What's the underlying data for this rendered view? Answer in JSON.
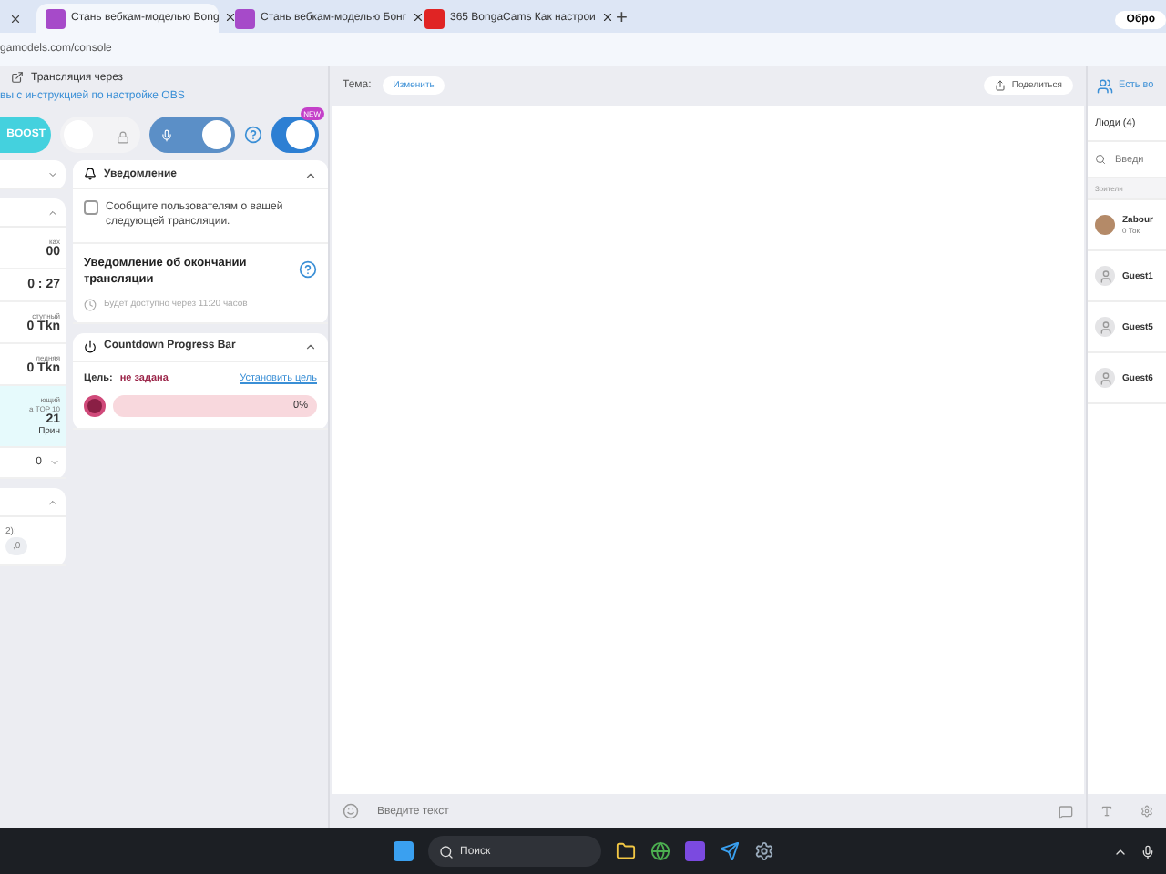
{
  "browser": {
    "tabs": [
      {
        "selected": false
      },
      {
        "title": "Стань вебкам-моделью Bong",
        "selected": true,
        "kind": "bonga"
      },
      {
        "title": "Стань вебкам-моделью Бонг",
        "selected": false,
        "kind": "bonga"
      },
      {
        "title": "365 BongaCams Как настрои",
        "selected": false,
        "kind": "video"
      }
    ],
    "new_tab": "+",
    "profile_button": "Обро",
    "address": "gamodels.com/console"
  },
  "stream": {
    "title": "Трансляция через",
    "link": "вы с инструкцией по настройке OBS",
    "controls": [
      {
        "kind": "boost",
        "label": "BOOST"
      },
      {
        "kind": "toggle",
        "on": false
      },
      {
        "kind": "mic",
        "on": true
      },
      {
        "kind": "help"
      },
      {
        "kind": "badge_toggle",
        "on": true,
        "badge": "NEW"
      }
    ]
  },
  "stats_column": {
    "cards": [
      {
        "expanded": false
      },
      {
        "expanded": true,
        "items": [
          {
            "kind": "stat",
            "label": "ках",
            "value": "00"
          },
          {
            "kind": "stat",
            "value": "0 : 27"
          },
          {
            "kind": "stat",
            "label": "ступный",
            "value": "0 Tkn"
          },
          {
            "kind": "stat",
            "label": "ледняя",
            "value": "0 Tkn"
          },
          {
            "kind": "highlight",
            "label": "ющий",
            "sub": "а TOP 10",
            "value": "21",
            "note": "Прин"
          },
          {
            "kind": "likes",
            "value": "0"
          }
        ]
      },
      {
        "expanded": true,
        "items": [
          {
            "kind": "stat",
            "label": "2):",
            "value": ",0"
          }
        ]
      }
    ]
  },
  "notification": {
    "title": "Уведомление",
    "checked": false,
    "text": "Сообщите пользователям о вашей следующей трансляции.",
    "end_title": "Уведомление об окончании трансляции",
    "available": "Будет доступно через 11:20 часов"
  },
  "countdown": {
    "title": "Countdown Progress Bar",
    "goal_label": "Цель:",
    "goal_value": "не задана",
    "set_goal": "Установить цель",
    "level": 0,
    "reading": "0%"
  },
  "center": {
    "topic_label": "Тема:",
    "edit": "Изменить",
    "share": "Поделиться",
    "input_placeholder": "Введите текст"
  },
  "people": {
    "header": "Есть во",
    "count_label": "Люди (4)",
    "search_placeholder": "Введи",
    "section": "Зрители",
    "users": [
      {
        "name": "Zabour",
        "sub": "0 Ток",
        "kind": "photo"
      },
      {
        "name": "Guest1",
        "kind": "guest"
      },
      {
        "name": "Guest5",
        "kind": "guest"
      },
      {
        "name": "Guest6",
        "kind": "guest"
      }
    ]
  },
  "taskbar": {
    "search": "Поиск"
  }
}
